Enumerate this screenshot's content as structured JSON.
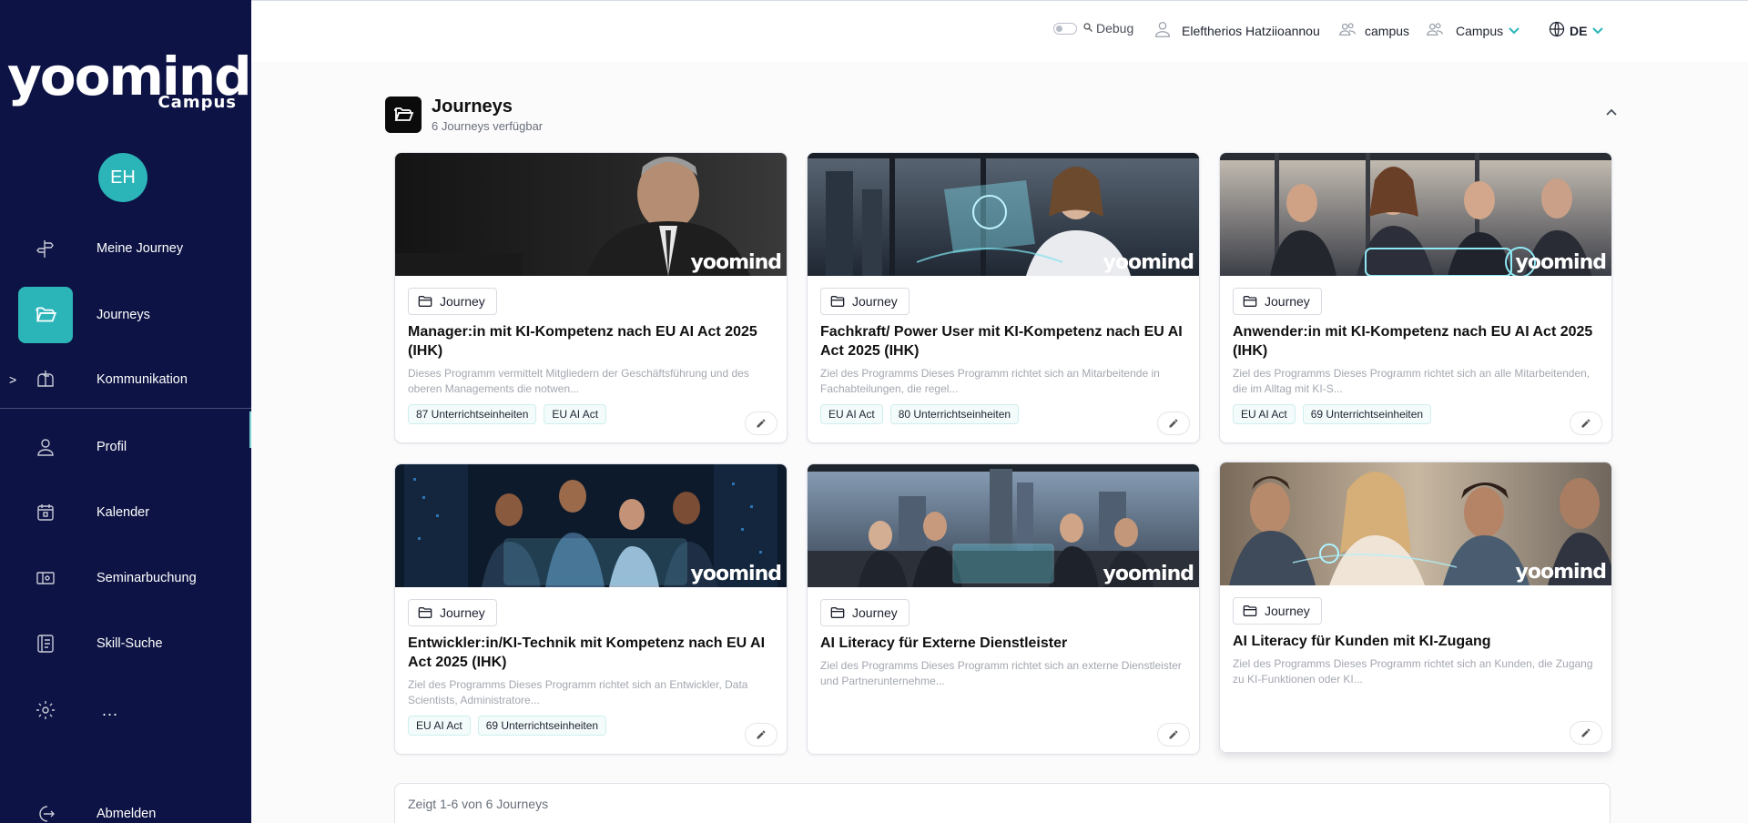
{
  "app": {
    "logo_text": "yoomind",
    "logo_sub": "Campus",
    "watermark": "yoomind"
  },
  "user": {
    "initials": "EH",
    "name": "Eleftherios Hatziioannou"
  },
  "sidebar": {
    "items": [
      {
        "label": "Meine Journey",
        "icon": "signpost-icon"
      },
      {
        "label": "Journeys",
        "icon": "folder-open-icon",
        "active": true
      },
      {
        "label": "Kommunikation",
        "icon": "mailbox-icon",
        "caret": ">"
      },
      {
        "label": "Profil",
        "icon": "user-icon"
      },
      {
        "label": "Kalender",
        "icon": "calendar-icon"
      },
      {
        "label": "Seminarbuchung",
        "icon": "ticket-icon"
      },
      {
        "label": "Skill-Suche",
        "icon": "skill-book-icon"
      }
    ],
    "more": "...",
    "logout": "Abmelden"
  },
  "topbar": {
    "debug": "Debug",
    "tenant": "campus",
    "tenant_select": "Campus",
    "language": "DE"
  },
  "section": {
    "title": "Journeys",
    "subtitle": "6 Journeys verfügbar"
  },
  "cards": [
    {
      "badge": "Journey",
      "title": "Manager:in mit KI-Kompetenz nach EU AI Act 2025 (IHK)",
      "desc": "Dieses Programm vermittelt Mitgliedern der Geschäftsführung und des oberen Managements die notwen...",
      "tags": [
        "87 Unterrichtseinheiten",
        "EU AI Act"
      ]
    },
    {
      "badge": "Journey",
      "title": "Fachkraft/ Power User mit KI-Kompetenz nach EU AI Act 2025 (IHK)",
      "desc": "Ziel des Programms Dieses Programm richtet sich an Mitarbeitende in Fachabteilungen, die regel...",
      "tags": [
        "EU AI Act",
        "80 Unterrichtseinheiten"
      ]
    },
    {
      "badge": "Journey",
      "title": "Anwender:in mit KI-Kompetenz nach EU AI Act 2025 (IHK)",
      "desc": "Ziel des Programms Dieses Programm richtet sich an alle Mitarbeitenden, die im Alltag mit KI-S...",
      "tags": [
        "EU AI Act",
        "69 Unterrichtseinheiten"
      ]
    },
    {
      "badge": "Journey",
      "title": "Entwickler:in/KI-Technik mit Kompetenz nach EU AI Act 2025 (IHK)",
      "desc": "Ziel des Programms Dieses Programm richtet sich an Entwickler, Data Scientists, Administratore...",
      "tags": [
        "EU AI Act",
        "69 Unterrichtseinheiten"
      ]
    },
    {
      "badge": "Journey",
      "title": "AI Literacy für Externe Dienstleister",
      "desc": "Ziel des Programms Dieses Programm richtet sich an externe Dienstleister und Partnerunternehme...",
      "tags": []
    },
    {
      "badge": "Journey",
      "title": "AI Literacy für Kunden mit KI-Zugang",
      "desc": "Ziel des Programms Dieses Programm richtet sich an Kunden, die Zugang zu KI-Funktionen oder KI...",
      "tags": []
    }
  ],
  "pagination": {
    "text": "Zeigt 1-6 von 6 Journeys"
  },
  "colors": {
    "sidebar": "#0d1344",
    "accent": "#2bb5b9"
  }
}
